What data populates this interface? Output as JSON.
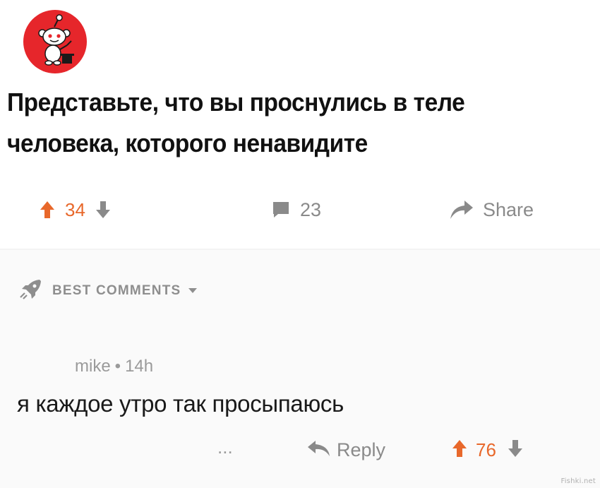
{
  "post": {
    "title_line1": "Представьте, что вы проснулись в теле",
    "title_line2": "человека, которого ненавидите",
    "score": "34",
    "comments_count": "23",
    "share_label": "Share"
  },
  "comments_section": {
    "sort_label": "BEST COMMENTS"
  },
  "comment": {
    "author": "mike",
    "separator": "•",
    "age": "14h",
    "text": "я каждое утро так просыпаюсь",
    "more_label": "...",
    "reply_label": "Reply",
    "score": "76"
  },
  "watermark": "Fishki.net",
  "colors": {
    "upvote": "#e8682b",
    "muted": "#8a8a8a",
    "avatar_bg": "#e6262b"
  },
  "icons": [
    "reddit-snoo-icon",
    "upvote-arrow-icon",
    "downvote-arrow-icon",
    "comment-bubble-icon",
    "share-arrow-icon",
    "rocket-icon",
    "chevron-down-icon",
    "reply-arrow-icon"
  ]
}
